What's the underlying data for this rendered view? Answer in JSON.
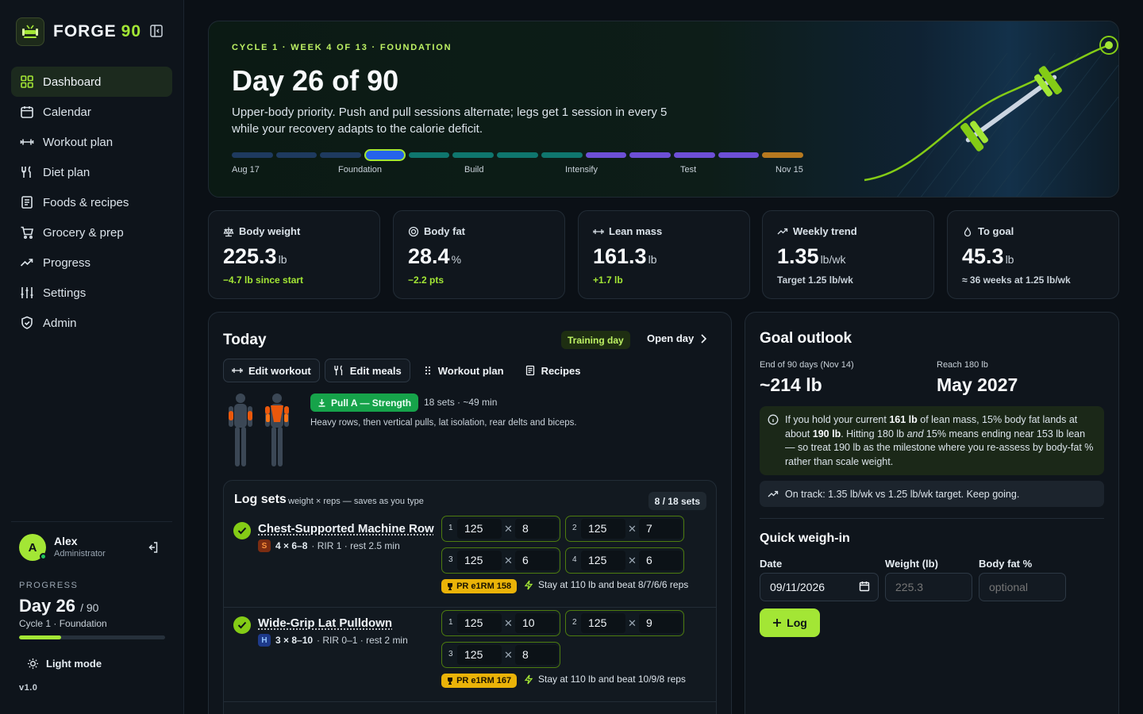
{
  "brand": {
    "name": "FORGE",
    "num": "90"
  },
  "nav": [
    {
      "label": "Dashboard",
      "icon": "grid-icon",
      "active": true
    },
    {
      "label": "Calendar",
      "icon": "calendar-icon"
    },
    {
      "label": "Workout plan",
      "icon": "dumbbell-icon"
    },
    {
      "label": "Diet plan",
      "icon": "utensils-icon"
    },
    {
      "label": "Foods & recipes",
      "icon": "book-icon"
    },
    {
      "label": "Grocery & prep",
      "icon": "cart-icon"
    },
    {
      "label": "Progress",
      "icon": "trend-icon"
    },
    {
      "label": "Settings",
      "icon": "sliders-icon"
    },
    {
      "label": "Admin",
      "icon": "shield-icon"
    }
  ],
  "user": {
    "initial": "A",
    "name": "Alex",
    "role": "Administrator"
  },
  "progress": {
    "label": "PROGRESS",
    "day": "Day 26",
    "of": "/ 90",
    "cycle": "Cycle 1",
    "phase": "Foundation",
    "fraction": 0.289
  },
  "light_mode": "Light mode",
  "version": "v1.0",
  "hero": {
    "kicker": [
      "CYCLE 1",
      "WEEK 4 OF 13",
      "FOUNDATION"
    ],
    "title": "Day 26 of 90",
    "desc": "Upper-body priority. Push and pull sessions alternate; legs get 1 session in every 5 while your recovery adapts to the calorie deficit.",
    "phases": [
      {
        "name": "foundation",
        "weeks": 4,
        "color": "#1e3a5f"
      },
      {
        "name": "build",
        "weeks": 4,
        "color": "#0f766e"
      },
      {
        "name": "intensify",
        "weeks": 4,
        "color": "#6d4fd6"
      },
      {
        "name": "test",
        "weeks": 1,
        "color": "#b7791f"
      }
    ],
    "current_week": 4,
    "labels": [
      "Aug 17",
      "Foundation",
      "Build",
      "Intensify",
      "Test",
      "Nov 15"
    ]
  },
  "stats": [
    {
      "label": "Body weight",
      "icon": "scale-icon",
      "value": "225.3",
      "unit": "lb",
      "sub": "−4.7 lb since start",
      "sub_style": "green"
    },
    {
      "label": "Body fat",
      "icon": "target-icon",
      "value": "28.4",
      "unit": "%",
      "sub": "−2.2 pts",
      "sub_style": "green"
    },
    {
      "label": "Lean mass",
      "icon": "dumbbell-icon",
      "value": "161.3",
      "unit": "lb",
      "sub": "+1.7 lb",
      "sub_style": "green"
    },
    {
      "label": "Weekly trend",
      "icon": "trend-icon",
      "value": "1.35",
      "unit": "lb/wk",
      "sub": "Target 1.25 lb/wk",
      "sub_style": "muted"
    },
    {
      "label": "To goal",
      "icon": "flame-icon",
      "value": "45.3",
      "unit": "lb",
      "sub": "≈ 36 weeks at 1.25 lb/wk",
      "sub_style": "muted"
    }
  ],
  "today": {
    "title": "Today",
    "badge": "Training day",
    "open_day": "Open day",
    "buttons": [
      "Edit workout",
      "Edit meals",
      "Workout plan",
      "Recipes"
    ],
    "workout_chip": "Pull A — Strength",
    "workout_meta": "18 sets · ~49 min",
    "workout_desc": "Heavy rows, then vertical pulls, lat isolation, rear delts and biceps.",
    "log": {
      "title": "Log sets",
      "hint": "weight × reps — saves as you type",
      "count": "8 / 18 sets",
      "exercises": [
        {
          "name": "Chest-Supported Machine Row",
          "tag": "S",
          "tag_color": "#7c2d12",
          "tag_text": "#fb923c",
          "scheme": "4 × 6–8",
          "rir": "RIR 1",
          "rest": "rest 2.5 min",
          "sets": [
            {
              "n": "1",
              "w": "125",
              "r": "8"
            },
            {
              "n": "2",
              "w": "125",
              "r": "7"
            },
            {
              "n": "3",
              "w": "125",
              "r": "6"
            },
            {
              "n": "4",
              "w": "125",
              "r": "6"
            }
          ],
          "pr": "PR e1RM 158",
          "note": "Stay at 110 lb and beat 8/7/6/6 reps"
        },
        {
          "name": "Wide-Grip Lat Pulldown",
          "tag": "H",
          "tag_color": "#1e3a8a",
          "tag_text": "#93c5fd",
          "scheme": "3 × 8–10",
          "rir": "RIR 0–1",
          "rest": "rest 2 min",
          "sets": [
            {
              "n": "1",
              "w": "125",
              "r": "10"
            },
            {
              "n": "2",
              "w": "125",
              "r": "9"
            },
            {
              "n": "3",
              "w": "125",
              "r": "8"
            }
          ],
          "pr": "PR e1RM 167",
          "note": "Stay at 110 lb and beat 10/9/8 reps"
        }
      ]
    }
  },
  "goal": {
    "title": "Goal outlook",
    "k1": "End of 90 days (Nov 14)",
    "v1": "~214 lb",
    "k2": "Reach 180 lb",
    "v2": "May 2027",
    "note": {
      "p1": "If you hold your current ",
      "b1": "161 lb",
      "p2": " of lean mass, 15% body fat lands at about ",
      "b2": "190 lb",
      "p3": ". Hitting 180 lb ",
      "i1": "and",
      "p4": " 15% means ending near 153 lb lean — so treat 190 lb as the milestone where you re-assess by body-fat % rather than scale weight."
    },
    "ontrack": "On track: 1.35 lb/wk vs 1.25 lb/wk target. Keep going.",
    "quick": {
      "title": "Quick weigh-in",
      "date_label": "Date",
      "date_value": "09/11/2026",
      "weight_label": "Weight (lb)",
      "weight_placeholder": "225.3",
      "fat_label": "Body fat %",
      "fat_placeholder": "optional",
      "log_label": "Log"
    }
  }
}
